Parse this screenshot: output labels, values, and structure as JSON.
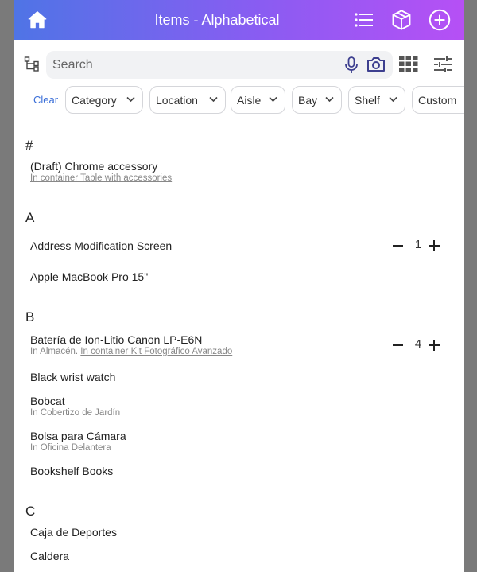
{
  "header": {
    "title": "Items - Alphabetical",
    "icons": [
      "home-icon",
      "list-icon",
      "box-icon",
      "add-circle-icon"
    ]
  },
  "search": {
    "placeholder": "Search"
  },
  "filters": {
    "clear_label": "Clear",
    "chips": [
      "Category",
      "Location",
      "Aisle",
      "Bay",
      "Shelf",
      "Custom"
    ]
  },
  "sections": [
    {
      "letter": "#",
      "items": [
        {
          "title": "(Draft) Chrome accessory",
          "sub_prefix": "",
          "sub_link": "In container Table with accessories"
        }
      ]
    },
    {
      "letter": "A",
      "items": [
        {
          "title": "Address Modification Screen",
          "qty": "1"
        },
        {
          "title": "Apple MacBook Pro 15\""
        }
      ]
    },
    {
      "letter": "B",
      "items": [
        {
          "title": "Batería de Ion-Litio Canon LP-E6N",
          "sub_prefix": "In Almacén. ",
          "sub_link": "In container Kit Fotográfico Avanzado",
          "qty": "4"
        },
        {
          "title": "Black wrist watch"
        },
        {
          "title": "Bobcat",
          "sub_prefix": "In Cobertizo de Jardín"
        },
        {
          "title": "Bolsa para Cámara",
          "sub_prefix": "In Oficina Delantera"
        },
        {
          "title": "Bookshelf Books"
        }
      ]
    },
    {
      "letter": "C",
      "items": [
        {
          "title": "Caja de Deportes"
        },
        {
          "title": "Caldera"
        }
      ]
    }
  ],
  "colors": {
    "accent_start": "#4f74e6",
    "accent_end": "#b650f5",
    "link": "#3b6fd8",
    "camera": "#3d3f8f"
  }
}
